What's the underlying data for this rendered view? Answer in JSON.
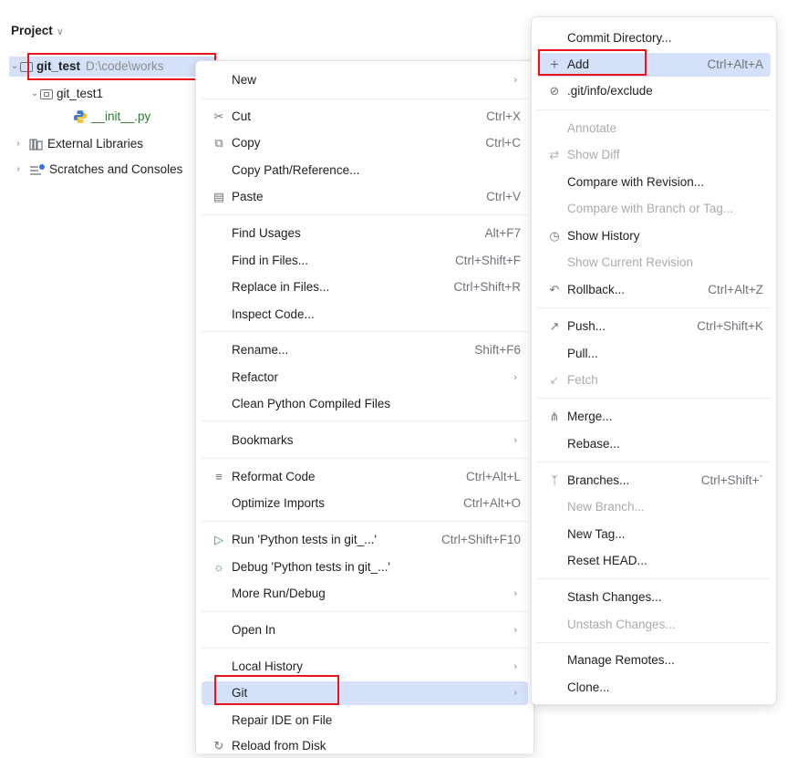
{
  "panel": {
    "title": "Project",
    "title_chevron": "∨"
  },
  "tree": {
    "root_name": "git_test",
    "root_path": "D:\\code\\works",
    "child_folder": "git_test1",
    "file": "__init__.py",
    "external_libraries": "External Libraries",
    "scratches": "Scratches and Consoles"
  },
  "context_menu": {
    "items": [
      {
        "label": "New",
        "shortcut": "",
        "submenu": true
      },
      {
        "label": "Cut",
        "shortcut": "Ctrl+X",
        "icon": "scissors-icon"
      },
      {
        "label": "Copy",
        "shortcut": "Ctrl+C",
        "icon": "copy-icon"
      },
      {
        "label": "Copy Path/Reference...",
        "shortcut": ""
      },
      {
        "label": "Paste",
        "shortcut": "Ctrl+V",
        "icon": "paste-icon"
      },
      {
        "label": "Find Usages",
        "shortcut": "Alt+F7"
      },
      {
        "label": "Find in Files...",
        "shortcut": "Ctrl+Shift+F"
      },
      {
        "label": "Replace in Files...",
        "shortcut": "Ctrl+Shift+R"
      },
      {
        "label": "Inspect Code...",
        "shortcut": ""
      },
      {
        "label": "Rename...",
        "shortcut": "Shift+F6"
      },
      {
        "label": "Refactor",
        "shortcut": "",
        "submenu": true
      },
      {
        "label": "Clean Python Compiled Files",
        "shortcut": ""
      },
      {
        "label": "Bookmarks",
        "shortcut": "",
        "submenu": true
      },
      {
        "label": "Reformat Code",
        "shortcut": "Ctrl+Alt+L",
        "icon": "reformat-icon"
      },
      {
        "label": "Optimize Imports",
        "shortcut": "Ctrl+Alt+O"
      },
      {
        "label": "Run 'Python tests in git_...'",
        "shortcut": "Ctrl+Shift+F10",
        "icon": "run-icon"
      },
      {
        "label": "Debug 'Python tests in git_...'",
        "shortcut": "",
        "icon": "debug-icon"
      },
      {
        "label": "More Run/Debug",
        "shortcut": "",
        "submenu": true
      },
      {
        "label": "Open In",
        "shortcut": "",
        "submenu": true
      },
      {
        "label": "Local History",
        "shortcut": "",
        "submenu": true
      },
      {
        "label": "Git",
        "shortcut": "",
        "submenu": true
      },
      {
        "label": "Repair IDE on File",
        "shortcut": ""
      },
      {
        "label": "Reload from Disk",
        "shortcut": "",
        "icon": "reload-icon"
      }
    ]
  },
  "git_menu": {
    "items": [
      {
        "label": "Commit Directory...",
        "shortcut": ""
      },
      {
        "label": "Add",
        "shortcut": "Ctrl+Alt+A",
        "icon": "plus-icon"
      },
      {
        "label": ".git/info/exclude",
        "shortcut": "",
        "icon": "ignore-icon"
      },
      {
        "label": "Annotate",
        "shortcut": ""
      },
      {
        "label": "Show Diff",
        "shortcut": "",
        "icon": "diff-icon"
      },
      {
        "label": "Compare with Revision...",
        "shortcut": ""
      },
      {
        "label": "Compare with Branch or Tag...",
        "shortcut": ""
      },
      {
        "label": "Show History",
        "shortcut": "",
        "icon": "history-icon"
      },
      {
        "label": "Show Current Revision",
        "shortcut": ""
      },
      {
        "label": "Rollback...",
        "shortcut": "Ctrl+Alt+Z",
        "icon": "rollback-icon"
      },
      {
        "label": "Push...",
        "shortcut": "Ctrl+Shift+K",
        "icon": "push-icon"
      },
      {
        "label": "Pull...",
        "shortcut": ""
      },
      {
        "label": "Fetch",
        "shortcut": "",
        "icon": "fetch-icon"
      },
      {
        "label": "Merge...",
        "shortcut": "",
        "icon": "merge-icon"
      },
      {
        "label": "Rebase...",
        "shortcut": ""
      },
      {
        "label": "Branches...",
        "shortcut": "Ctrl+Shift+`",
        "icon": "branch-icon"
      },
      {
        "label": "New Branch...",
        "shortcut": ""
      },
      {
        "label": "New Tag...",
        "shortcut": ""
      },
      {
        "label": "Reset HEAD...",
        "shortcut": ""
      },
      {
        "label": "Stash Changes...",
        "shortcut": ""
      },
      {
        "label": "Unstash Changes...",
        "shortcut": ""
      },
      {
        "label": "Manage Remotes...",
        "shortcut": ""
      },
      {
        "label": "Clone...",
        "shortcut": ""
      }
    ]
  }
}
